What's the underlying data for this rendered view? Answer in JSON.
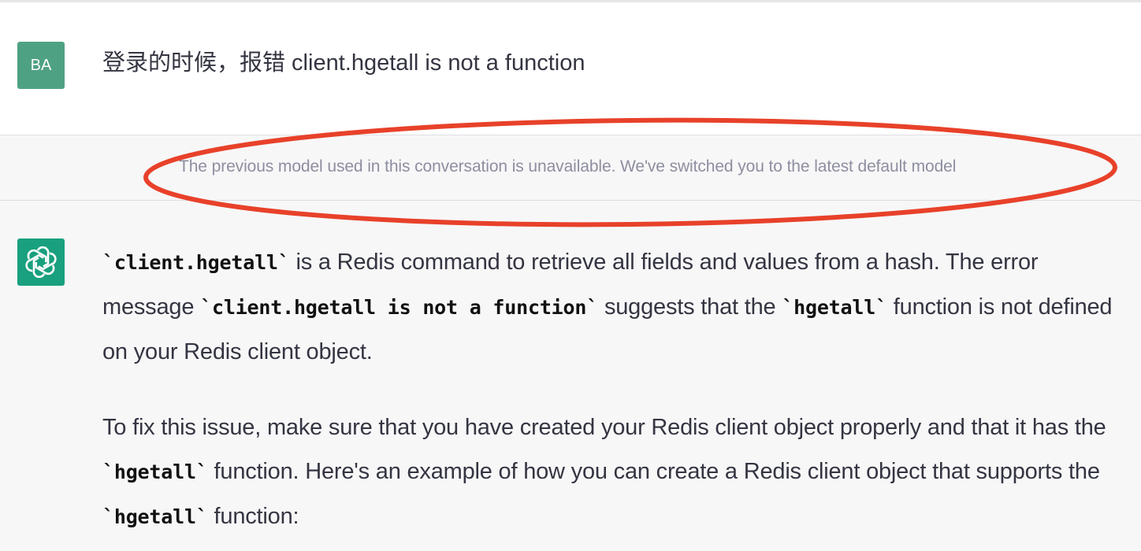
{
  "user_message": {
    "avatar_initials": "BA",
    "text": "登录的时候，报错 client.hgetall is not a function"
  },
  "notice": {
    "text": "The previous model used in this conversation is unavailable. We've switched you to the latest default model"
  },
  "assistant_message": {
    "p1": {
      "code1": "`client.hgetall`",
      "t1": " is a Redis command to retrieve all fields and values from a hash. The error message ",
      "code2": "`client.hgetall is not a function`",
      "t2": " suggests that the ",
      "code3": "`hgetall`",
      "t3": " function is not defined on your Redis client object."
    },
    "p2": {
      "t1": "To fix this issue, make sure that you have created your Redis client object properly and that it has the ",
      "code1": "`hgetall`",
      "t2": " function. Here's an example of how you can create a Redis client object that supports the ",
      "code2": "`hgetall`",
      "t3": " function:"
    }
  },
  "colors": {
    "user_avatar": "#4fa184",
    "assistant_avatar": "#19a07e",
    "annotation": "#e8412a",
    "notice_text": "#8e8ea0"
  },
  "icons": {
    "assistant_avatar": "openai-logo-icon"
  }
}
